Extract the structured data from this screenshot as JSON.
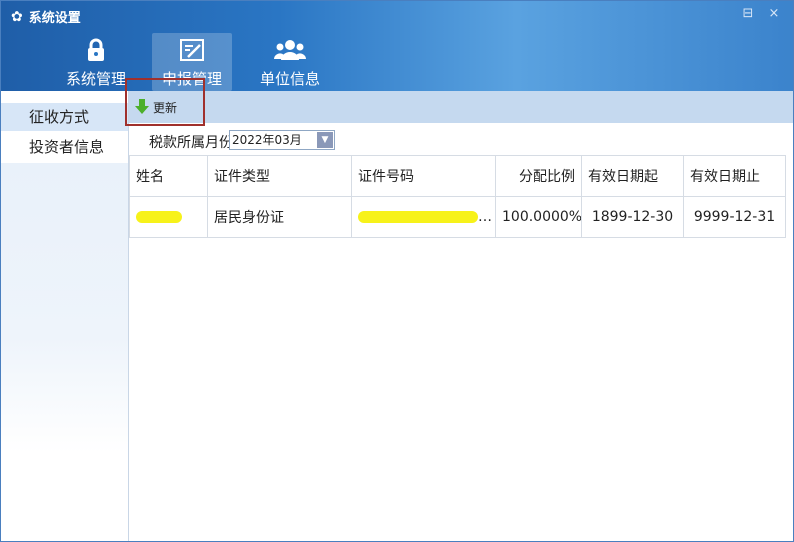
{
  "window": {
    "title": "系统设置",
    "restore_icon": "⊟",
    "close_icon": "×"
  },
  "nav": {
    "tabs": [
      {
        "label": "系统管理",
        "icon": "lock-icon"
      },
      {
        "label": "申报管理",
        "icon": "edit-icon"
      },
      {
        "label": "单位信息",
        "icon": "users-icon"
      }
    ],
    "active": 1
  },
  "sidebar": {
    "items": [
      {
        "label": "征收方式"
      },
      {
        "label": "投资者信息"
      }
    ],
    "active": 0
  },
  "toolbar": {
    "update_label": "更新"
  },
  "filter": {
    "period_label": "税款所属月份",
    "period_value": "2022年03月"
  },
  "table": {
    "columns": [
      "姓名",
      "证件类型",
      "证件号码",
      "分配比例",
      "有效日期起",
      "有效日期止"
    ],
    "rows": [
      {
        "name": "",
        "id_type": "居民身份证",
        "id_number": "…",
        "ratio": "100.0000%",
        "start": "1899-12-30",
        "end": "9999-12-31"
      }
    ]
  },
  "colors": {
    "header_blue": "#2a76c4",
    "toolbar_bg": "#c5d9ef",
    "highlight_box": "#a0302c",
    "redaction": "#f7f21a"
  }
}
